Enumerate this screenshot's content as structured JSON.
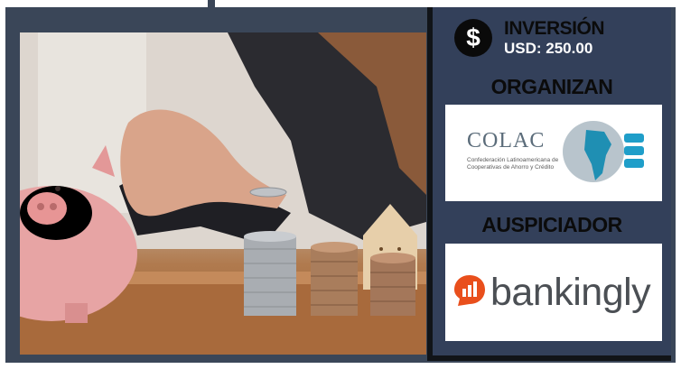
{
  "investment": {
    "label": "INVERSIÓN",
    "amount": "USD: 250.00",
    "icon": "dollar-coin-icon"
  },
  "organizers": {
    "heading": "ORGANIZAN",
    "logo_name": "COLAC",
    "logo_subtitle": "Confederación Latinoamericana de Cooperativas de Ahorro y Crédito"
  },
  "sponsor": {
    "heading": "AUSPICIADOR",
    "logo_name": "bankingly",
    "brand_color": "#e94f1c"
  },
  "colors": {
    "panel": "#33405a",
    "frame": "#3a4658",
    "heading_text": "#0b0b0b"
  }
}
